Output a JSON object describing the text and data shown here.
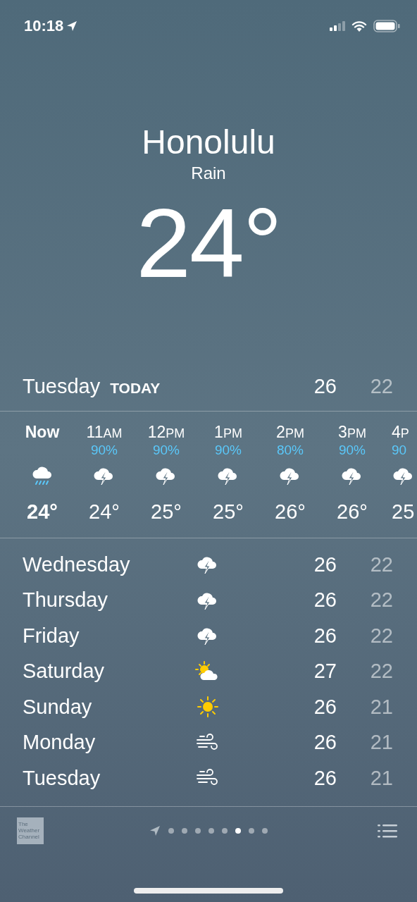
{
  "status_bar": {
    "time": "10:18"
  },
  "location": {
    "city": "Honolulu",
    "condition": "Rain",
    "temperature": "24°"
  },
  "today": {
    "day": "Tuesday",
    "label": "TODAY",
    "high": "26",
    "low": "22"
  },
  "hourly": [
    {
      "hour": "Now",
      "kind": "rain",
      "temp": "24°",
      "now": true
    },
    {
      "hour": "11",
      "period": "AM",
      "chance": "90%",
      "kind": "thunderstorm",
      "temp": "24°",
      "now": false
    },
    {
      "hour": "12",
      "period": "PM",
      "chance": "90%",
      "kind": "thunderstorm",
      "temp": "25°",
      "now": false
    },
    {
      "hour": "1",
      "period": "PM",
      "chance": "90%",
      "kind": "thunderstorm",
      "temp": "25°",
      "now": false
    },
    {
      "hour": "2",
      "period": "PM",
      "chance": "80%",
      "kind": "thunderstorm",
      "temp": "26°",
      "now": false
    },
    {
      "hour": "3",
      "period": "PM",
      "chance": "90%",
      "kind": "thunderstorm",
      "temp": "26°",
      "now": false
    },
    {
      "hour": "4",
      "period": "P",
      "chance": "90",
      "kind": "thunderstorm",
      "temp": "25",
      "now": false
    }
  ],
  "daily": [
    {
      "day": "Wednesday",
      "kind": "thunderstorm",
      "high": "26",
      "low": "22"
    },
    {
      "day": "Thursday",
      "kind": "thunderstorm",
      "high": "26",
      "low": "22"
    },
    {
      "day": "Friday",
      "kind": "thunderstorm",
      "high": "26",
      "low": "22"
    },
    {
      "day": "Saturday",
      "kind": "partly-sunny",
      "high": "27",
      "low": "22"
    },
    {
      "day": "Sunday",
      "kind": "sunny",
      "high": "26",
      "low": "21"
    },
    {
      "day": "Monday",
      "kind": "windy",
      "high": "26",
      "low": "21"
    },
    {
      "day": "Tuesday",
      "kind": "windy",
      "high": "26",
      "low": "21"
    }
  ],
  "footer": {
    "logo": [
      "The",
      "Weather",
      "Channel"
    ],
    "pages": [
      {
        "selected": false
      },
      {
        "selected": false
      },
      {
        "selected": false
      },
      {
        "selected": false
      },
      {
        "selected": false
      },
      {
        "selected": true
      },
      {
        "selected": false
      },
      {
        "selected": false
      }
    ]
  }
}
